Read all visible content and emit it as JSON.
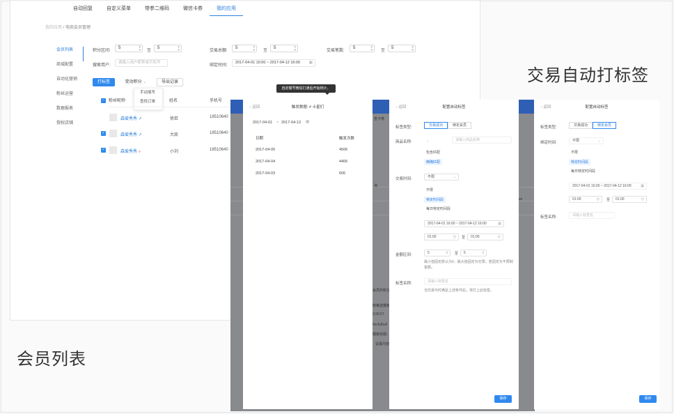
{
  "labels": {
    "member_list": "会员列表",
    "auto_tag": "交易自动打标签"
  },
  "member": {
    "topnav": [
      "自动回复",
      "自定义菜单",
      "带参二维码",
      "微信卡券",
      "我的应用"
    ],
    "breadcrumb": {
      "parent": "我的应用",
      "sep": "/",
      "current": "电商会员管理"
    },
    "sidebar": [
      "会员列表",
      "商城配置",
      "自动化营销",
      "粉丝运营",
      "数据报表",
      "授权店铺"
    ],
    "filters": {
      "points_label": "积分区间:",
      "points_from": "5",
      "points_to": "5",
      "to": "至",
      "trade_total_label": "交易总额:",
      "trade_total_from": "5",
      "trade_total_to": "5",
      "trade_count_label": "交易笔数:",
      "trade_count_from": "5",
      "trade_count_to": "5",
      "search_label": "搜索用户:",
      "search_placeholder": "请输入用户昵称或手机号",
      "bind_time_label": "绑定时间:",
      "bind_time_value": "2017-04-01 16:00 ~ 2017-04-12 16:00"
    },
    "actions": {
      "tag": "打标签",
      "change_points": "变动积分",
      "export": "导出记录"
    },
    "popover": [
      "手动填写",
      "查找订单"
    ],
    "table": {
      "headers": [
        "粉丝昵称",
        "姓名",
        "手机号"
      ],
      "rows": [
        {
          "nick": "森爱秀秀",
          "name": "徐若",
          "phone": "18510640"
        },
        {
          "nick": "森爱秀秀",
          "name": "大凯",
          "phone": "18510640"
        },
        {
          "nick": "森爱秀秀",
          "name": "小刘",
          "phone": "18510640"
        }
      ]
    }
  },
  "tooltip": "自定模号微信打通后开始统计。",
  "panel1": {
    "back": "返回",
    "title": "触发数据:",
    "title_suffix": "# 士星们",
    "date_from": "2017-04-01",
    "date_sep": "~",
    "date_to": "2017-04-12",
    "headers": [
      "日期",
      "触发次数"
    ],
    "rows": [
      {
        "date": "2017-04-05",
        "count": "4506"
      },
      {
        "date": "2017-04-04",
        "count": "4406"
      },
      {
        "date": "2017-04-03",
        "count": "606"
      }
    ]
  },
  "panel2": {
    "back": "返回",
    "title": "配置自动标签",
    "tag_type_label": "标签类型:",
    "tag_types": [
      "交易成功",
      "绑定会员"
    ],
    "product_label": "商品名称:",
    "product_placeholder": "请输入商品名称",
    "product_opts": [
      "包含匹配",
      "精确匹配"
    ],
    "trade_time_label": "交易时间:",
    "trade_time_value": "不限",
    "trade_time_opts": [
      "不限",
      "特定时间段",
      "每日特定时间段"
    ],
    "range_value": "2017-04-01 16:00 ~ 2017-04-12 16:00",
    "time_from": "01:00",
    "time_to_label": "至",
    "time_to": "01:00",
    "amount_label": "金额区间:",
    "amount_from": "5",
    "amount_to_label": "至",
    "amount_to": "5",
    "amount_note": "最小值固定默认为0，最大值固定为无限，若固定为不限制金额。",
    "tag_name_label": "标签名称:",
    "tag_name_placeholder": "请输入标签名",
    "tag_name_note": "当交易与时满足上述条件后，将打上此标签。",
    "save": "保存"
  },
  "panel3": {
    "back": "返回",
    "title": "配置自动标签",
    "tag_type_label": "标签类型:",
    "tag_types": [
      "交易成功",
      "绑定会员"
    ],
    "bind_time_label": "绑定时间:",
    "bind_time_value": "不限",
    "bind_opts": [
      "不限",
      "特定时间段",
      "每日特定时间段"
    ],
    "range_value": "2017-04-01 16:00 ~ 2017-04-12 16:00",
    "time_from": "01:00",
    "time_to_label": "至",
    "time_to": "01:00",
    "tag_name_label": "标签名称:",
    "tag_name_placeholder": "请输入标签名",
    "save": "保存"
  },
  "fragments": [
    "签卡券",
    "询",
    "se",
    "会员的积分",
    "知推送模板",
    "3:26:57",
    "0xcfyt6uF",
    "模板标题：",
    "设置内容"
  ],
  "colors": {
    "accent": "#2f89ef",
    "mask": "#898a8d",
    "header_blue": "#2f5fb4"
  }
}
